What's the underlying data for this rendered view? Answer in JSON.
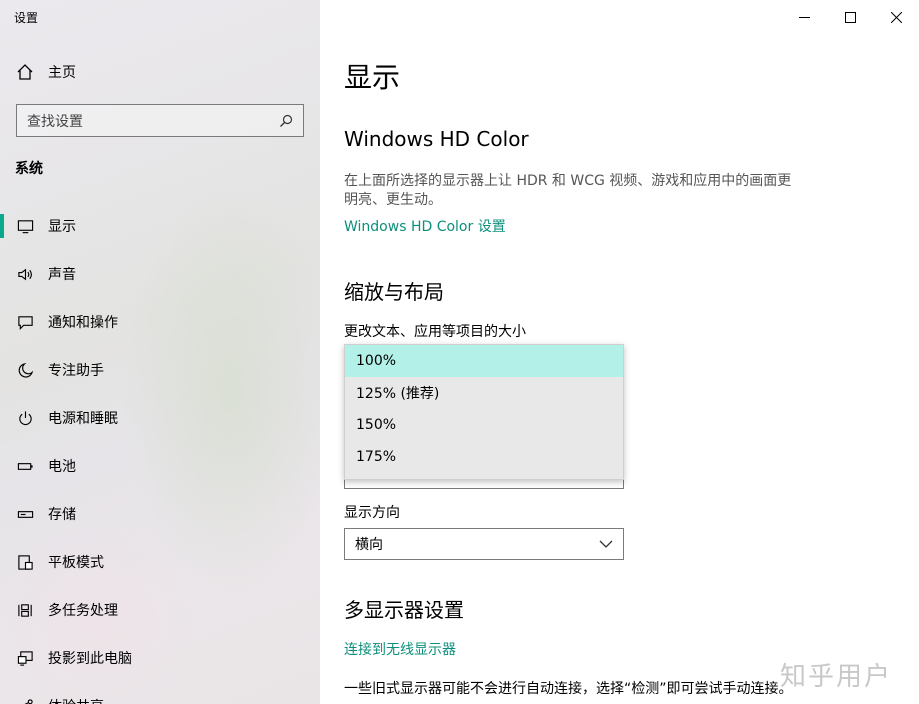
{
  "window": {
    "title": "设置"
  },
  "sidebar": {
    "home_label": "主页",
    "search_placeholder": "查找设置",
    "section": "系统",
    "items": [
      {
        "label": "显示",
        "icon": "monitor-icon"
      },
      {
        "label": "声音",
        "icon": "speaker-icon"
      },
      {
        "label": "通知和操作",
        "icon": "notification-icon"
      },
      {
        "label": "专注助手",
        "icon": "moon-icon"
      },
      {
        "label": "电源和睡眠",
        "icon": "power-icon"
      },
      {
        "label": "电池",
        "icon": "battery-icon"
      },
      {
        "label": "存储",
        "icon": "storage-icon"
      },
      {
        "label": "平板模式",
        "icon": "tablet-icon"
      },
      {
        "label": "多任务处理",
        "icon": "multitask-icon"
      },
      {
        "label": "投影到此电脑",
        "icon": "project-icon"
      },
      {
        "label": "体验共享",
        "icon": "share-icon"
      }
    ],
    "active_index": 0
  },
  "main": {
    "title": "显示",
    "hdr": {
      "heading": "Windows HD Color",
      "description": "在上面所选择的显示器上让 HDR 和 WCG 视频、游戏和应用中的画面更明亮、更生动。",
      "link": "Windows HD Color 设置"
    },
    "scale": {
      "heading": "缩放与布局",
      "label": "更改文本、应用等项目的大小",
      "options": [
        "100%",
        "125% (推荐)",
        "150%",
        "175%"
      ],
      "selected_index": 0
    },
    "orientation": {
      "label": "显示方向",
      "value": "横向"
    },
    "multi": {
      "heading": "多显示器设置",
      "link": "连接到无线显示器",
      "text": "一些旧式显示器可能不会进行自动连接，选择“检测”即可尝试手动连接。"
    }
  },
  "watermark": "知乎用户",
  "colors": {
    "accent": "#0aa88c",
    "link": "#0d8f7c",
    "selected_option": "#b3f0e8"
  }
}
